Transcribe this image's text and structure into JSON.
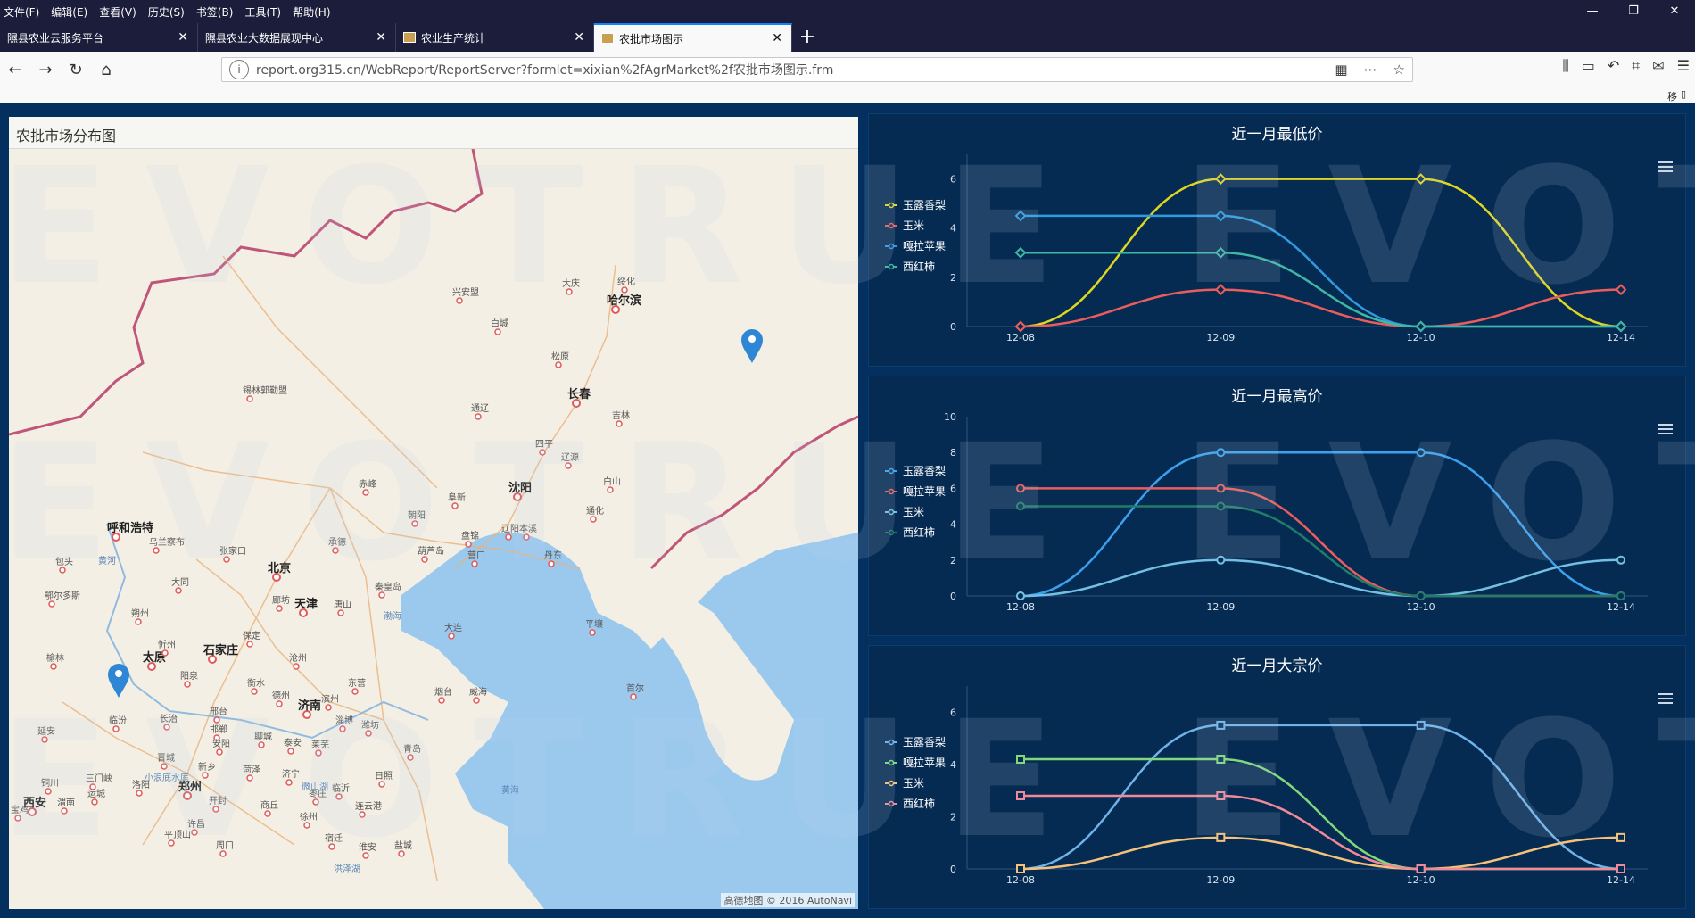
{
  "menu": [
    "文件(F)",
    "编辑(E)",
    "查看(V)",
    "历史(S)",
    "书签(B)",
    "工具(T)",
    "帮助(H)"
  ],
  "window_controls": [
    "—",
    "❐",
    "✕"
  ],
  "tabs": [
    {
      "label": "隰县农业云服务平台",
      "active": false
    },
    {
      "label": "隰县农业大数据展现中心",
      "active": false
    },
    {
      "label": "农业生产统计",
      "active": false
    },
    {
      "label": "农批市场图示",
      "active": true
    }
  ],
  "new_tab": "+",
  "url": "report.org315.cn/WebReport/ReportServer?formlet=xixian%2fAgrMarket%2f农批市场图示.frm",
  "mobile_bookmark": "移动版书签",
  "map": {
    "title": "农批市场分布图",
    "attribution": "高德地图 © 2016 AutoNavi",
    "cities": [
      "哈尔滨",
      "长春",
      "吉林",
      "沈阳",
      "北京",
      "天津",
      "呼和浩特",
      "太原",
      "石家庄",
      "济南",
      "郑州",
      "西安",
      "大庆",
      "绥化",
      "松原",
      "四平",
      "辽源",
      "白山",
      "通化",
      "赤峰",
      "朝阳",
      "阜新",
      "辽阳",
      "本溪",
      "盘锦",
      "营口",
      "葫芦岛",
      "秦皇岛",
      "承德",
      "张家口",
      "乌兰察布",
      "大同",
      "朔州",
      "忻州",
      "阳泉",
      "邢台",
      "邯郸",
      "衡水",
      "保定",
      "廊坊",
      "唐山",
      "沧州",
      "德州",
      "聊城",
      "滨州",
      "东营",
      "潍坊",
      "淄博",
      "泰安",
      "莱芜",
      "临沂",
      "日照",
      "青岛",
      "烟台",
      "威海",
      "大连",
      "丹东",
      "鄂尔多斯",
      "包头",
      "延安",
      "榆林",
      "临汾",
      "长治",
      "晋城",
      "安阳",
      "新乡",
      "开封",
      "商丘",
      "菏泽",
      "济宁",
      "枣庄",
      "徐州",
      "连云港",
      "宿迁",
      "淮安",
      "盐城",
      "周口",
      "许昌",
      "平顶山",
      "洛阳",
      "三门峡",
      "运城",
      "渭南",
      "铜川",
      "宝鸡",
      "兴安盟",
      "白城",
      "通辽",
      "锡林郭勒盟",
      "渤海",
      "黄海",
      "平壤",
      "首尔",
      "黄河",
      "小浪底水库",
      "洪泽湖",
      "微山湖"
    ]
  },
  "charts": [
    {
      "title": "近一月最低价",
      "categories": [
        "12-08",
        "12-09",
        "12-10",
        "12-14"
      ],
      "ylim": [
        0,
        7
      ],
      "yticks": [
        0,
        2,
        4,
        6
      ],
      "series": [
        {
          "name": "玉露香梨",
          "color": "#dfd622",
          "marker": "diamond",
          "values": [
            0,
            6,
            6,
            0
          ]
        },
        {
          "name": "玉米",
          "color": "#ea5d5d",
          "marker": "diamond",
          "values": [
            0,
            1.5,
            0,
            1.5
          ]
        },
        {
          "name": "嘎拉苹果",
          "color": "#2f9ae0",
          "marker": "diamond",
          "values": [
            4.5,
            4.5,
            0,
            0
          ]
        },
        {
          "name": "西红柿",
          "color": "#3fb7a4",
          "marker": "diamond",
          "values": [
            3,
            3,
            0,
            0
          ]
        }
      ]
    },
    {
      "title": "近一月最高价",
      "categories": [
        "12-08",
        "12-09",
        "12-10",
        "12-14"
      ],
      "ylim": [
        0,
        10
      ],
      "yticks": [
        0,
        2,
        4,
        6,
        8,
        10
      ],
      "series": [
        {
          "name": "玉露香梨",
          "color": "#3ba1ee",
          "marker": "circle",
          "values": [
            0,
            8,
            8,
            0
          ]
        },
        {
          "name": "嘎拉苹果",
          "color": "#ea5d5d",
          "marker": "circle",
          "values": [
            6,
            6,
            0,
            0
          ]
        },
        {
          "name": "玉米",
          "color": "#74c0e4",
          "marker": "circle",
          "values": [
            0,
            2,
            0,
            2
          ]
        },
        {
          "name": "西红柿",
          "color": "#1f7d6a",
          "marker": "circle",
          "values": [
            5,
            5,
            0,
            0
          ]
        }
      ]
    },
    {
      "title": "近一月大宗价",
      "categories": [
        "12-08",
        "12-09",
        "12-10",
        "12-14"
      ],
      "ylim": [
        0,
        7
      ],
      "yticks": [
        0,
        2,
        4,
        6
      ],
      "series": [
        {
          "name": "玉露香梨",
          "color": "#6fb3ea",
          "marker": "square",
          "values": [
            0,
            5.5,
            5.5,
            0
          ]
        },
        {
          "name": "嘎拉苹果",
          "color": "#7fd97a",
          "marker": "square",
          "values": [
            4.2,
            4.2,
            0,
            0
          ]
        },
        {
          "name": "玉米",
          "color": "#f4c27a",
          "marker": "square",
          "values": [
            0,
            1.2,
            0,
            1.2
          ]
        },
        {
          "name": "西红柿",
          "color": "#f08a9a",
          "marker": "square",
          "values": [
            2.8,
            2.8,
            0,
            0
          ]
        }
      ]
    }
  ]
}
